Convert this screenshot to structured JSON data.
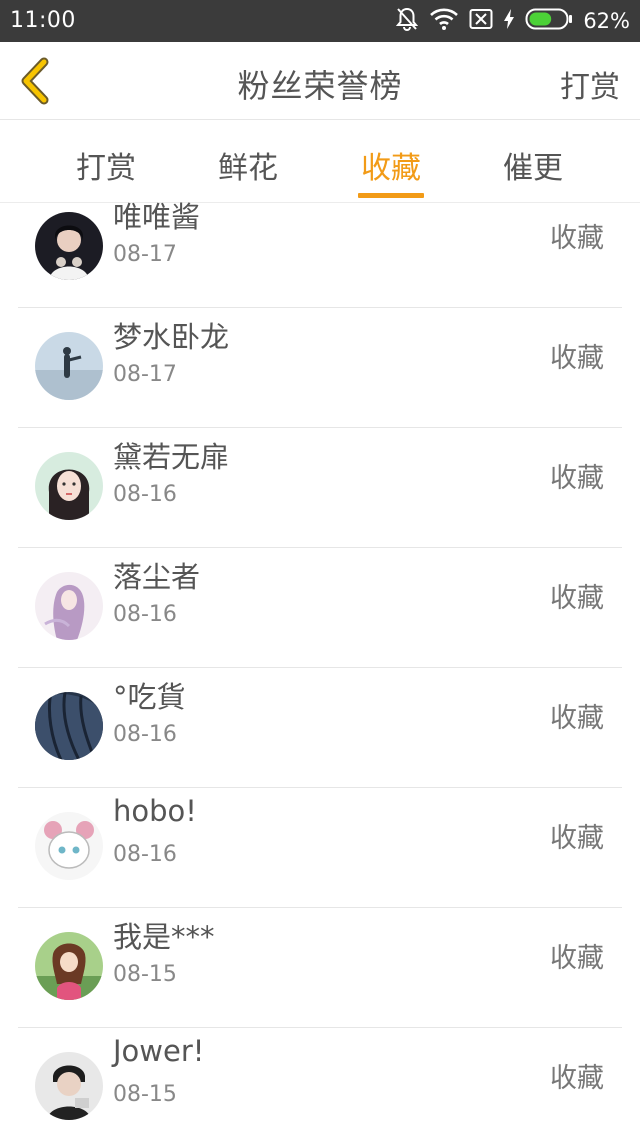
{
  "status_bar": {
    "time": "11:00",
    "battery_percent": "62%",
    "icons": [
      "bell-off-icon",
      "wifi-icon",
      "sim-off-icon",
      "charging-icon",
      "battery-icon"
    ],
    "battery_level": 0.62
  },
  "header": {
    "title": "粉丝荣誉榜",
    "action": "打赏",
    "back_icon": "chevron-left-icon"
  },
  "tabs": [
    {
      "label": "打赏",
      "active": false
    },
    {
      "label": "鲜花",
      "active": false
    },
    {
      "label": "收藏",
      "active": true
    },
    {
      "label": "催更",
      "active": false
    }
  ],
  "list": [
    {
      "name": "唯唯酱",
      "date": "08-17",
      "type": "收藏"
    },
    {
      "name": "梦水卧龙",
      "date": "08-17",
      "type": "收藏"
    },
    {
      "name": "黛若无扉",
      "date": "08-16",
      "type": "收藏"
    },
    {
      "name": "落尘者",
      "date": "08-16",
      "type": "收藏"
    },
    {
      "name": "°吃貨",
      "date": "08-16",
      "type": "收藏"
    },
    {
      "name": "hobo!",
      "date": "08-16",
      "type": "收藏"
    },
    {
      "name": "我是***",
      "date": "08-15",
      "type": "收藏"
    },
    {
      "name": "Jower!",
      "date": "08-15",
      "type": "收藏"
    }
  ],
  "colors": {
    "accent": "#f29b17",
    "status_bar_bg": "#3b3b3b",
    "divider": "#e6e6e6",
    "text": "#555555",
    "subtext": "#888888"
  }
}
